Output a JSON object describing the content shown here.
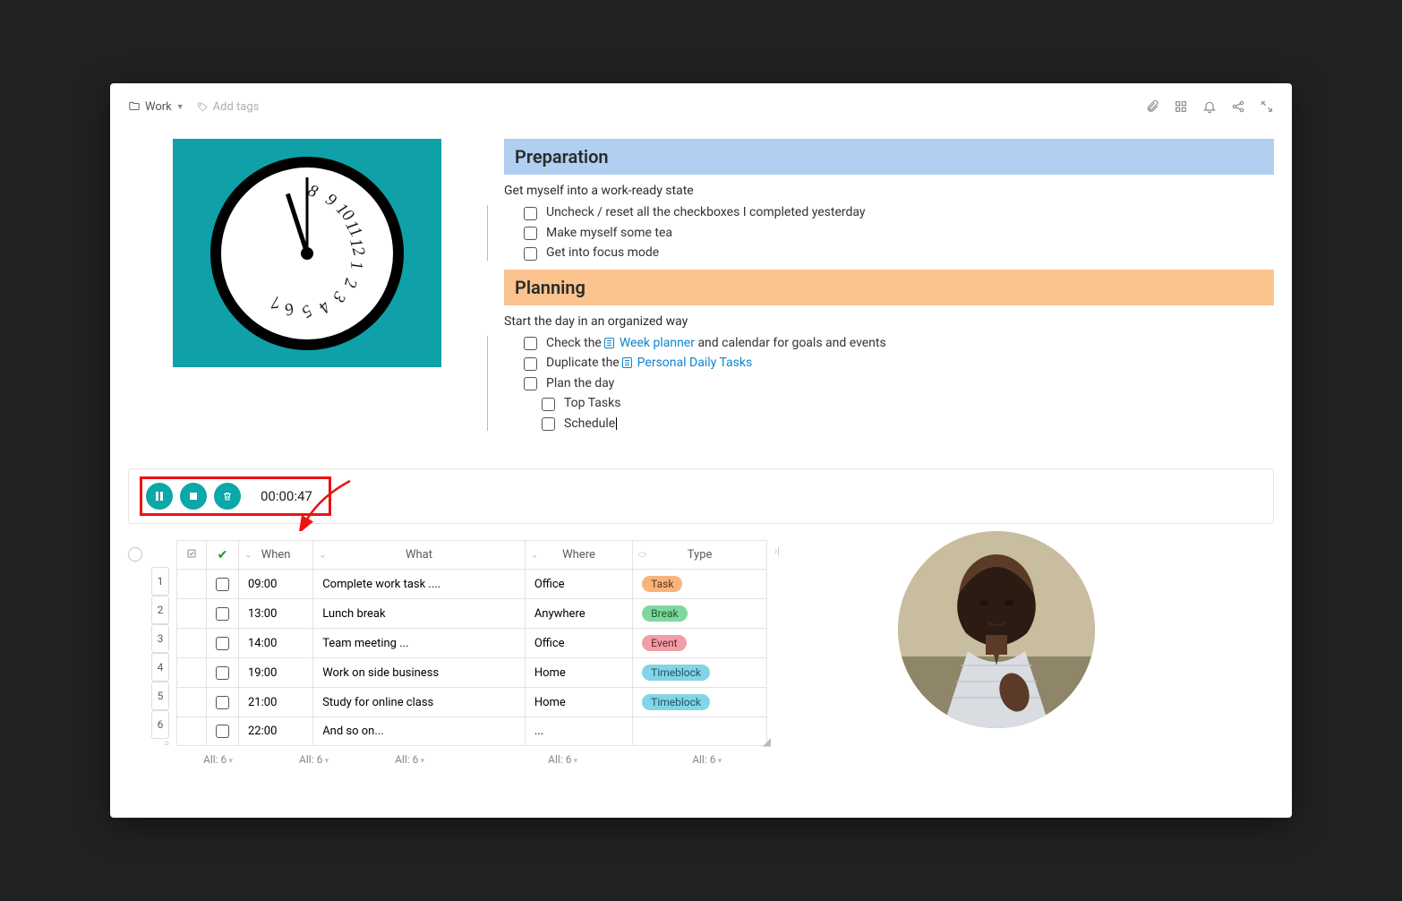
{
  "topbar": {
    "folder": "Work",
    "add_tags": "Add tags"
  },
  "sections": {
    "prep": {
      "title": "Preparation",
      "desc": "Get myself into a work-ready state",
      "items": [
        "Uncheck / reset all the checkboxes I completed yesterday",
        "Make myself some tea",
        "Get into focus mode"
      ]
    },
    "plan": {
      "title": "Planning",
      "desc": "Start the day in an organized way",
      "item1_pre": "Check the ",
      "item1_link": "Week planner",
      "item1_post": " and calendar for goals and events",
      "item2_pre": "Duplicate the ",
      "item2_link": "Personal Daily Tasks",
      "item3": "Plan the day",
      "sub1": "Top Tasks",
      "sub2": "Schedule"
    }
  },
  "timer": {
    "value": "00:00:47"
  },
  "table": {
    "headers": {
      "when": "When",
      "what": "What",
      "where": "Where",
      "type": "Type"
    },
    "rows": [
      {
        "idx": "1",
        "when": "09:00",
        "what": "Complete work task ....",
        "where": "Office",
        "type": "Task",
        "badge_class": "badge-task"
      },
      {
        "idx": "2",
        "when": "13:00",
        "what": "Lunch break",
        "where": "Anywhere",
        "type": "Break",
        "badge_class": "badge-break"
      },
      {
        "idx": "3",
        "when": "14:00",
        "what": "Team meeting ...",
        "where": "Office",
        "type": "Event",
        "badge_class": "badge-event"
      },
      {
        "idx": "4",
        "when": "19:00",
        "what": "Work on side business",
        "where": "Home",
        "type": "Timeblock",
        "badge_class": "badge-timeblock"
      },
      {
        "idx": "5",
        "when": "21:00",
        "what": "Study for online class",
        "where": "Home",
        "type": "Timeblock",
        "badge_class": "badge-timeblock"
      },
      {
        "idx": "6",
        "when": "22:00",
        "what": "And so on...",
        "where": "...",
        "type": "",
        "badge_class": ""
      }
    ],
    "footer": "All: 6"
  }
}
